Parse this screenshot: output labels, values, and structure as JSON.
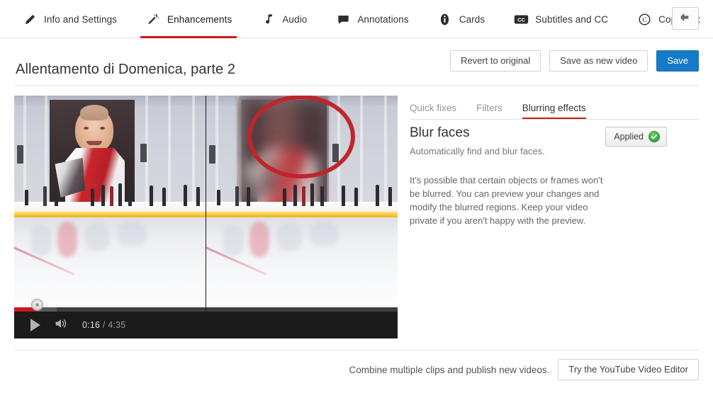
{
  "nav": {
    "tabs": [
      {
        "label": "Info and Settings",
        "icon": "pencil-icon",
        "active": false
      },
      {
        "label": "Enhancements",
        "icon": "magic-wand-icon",
        "active": true
      },
      {
        "label": "Audio",
        "icon": "music-note-icon",
        "active": false
      },
      {
        "label": "Annotations",
        "icon": "speech-bubble-icon",
        "active": false
      },
      {
        "label": "Cards",
        "icon": "info-circle-icon",
        "active": false
      },
      {
        "label": "Subtitles and CC",
        "icon": "closed-caption-icon",
        "active": false
      },
      {
        "label": "Copyright",
        "icon": "copyright-icon",
        "active": false
      }
    ],
    "back_button_icon": "back-arrow-icon"
  },
  "header": {
    "title": "Allentamento di Domenica, parte 2",
    "revert_label": "Revert to original",
    "save_as_new_label": "Save as new video",
    "save_label": "Save"
  },
  "player": {
    "play_icon": "play-icon",
    "volume_icon": "volume-icon",
    "current_time": "0:16",
    "separator": "/",
    "total_time": "4:35",
    "progress_percent": 6,
    "buffered_percent": 11,
    "scene_description": "Ice rink with large banner portrait; left half original, right half blurred with red circle highlight"
  },
  "panel": {
    "subtabs": [
      {
        "label": "Quick fixes",
        "active": false
      },
      {
        "label": "Filters",
        "active": false
      },
      {
        "label": "Blurring effects",
        "active": true
      }
    ],
    "blur": {
      "title": "Blur faces",
      "subtitle": "Automatically find and blur faces.",
      "applied_label": "Applied",
      "applied_icon": "green-check-icon",
      "body": "It's possible that certain objects or frames won't be blurred. You can preview your changes and modify the blurred regions. Keep your video private if you aren't happy with the preview."
    }
  },
  "footer": {
    "text": "Combine multiple clips and publish new videos.",
    "button_label": "Try the YouTube Video Editor"
  },
  "colors": {
    "accent_red": "#cc181e",
    "primary_blue": "#167ac6",
    "highlight_circle": "#c0252b",
    "applied_green": "#3cb043"
  }
}
